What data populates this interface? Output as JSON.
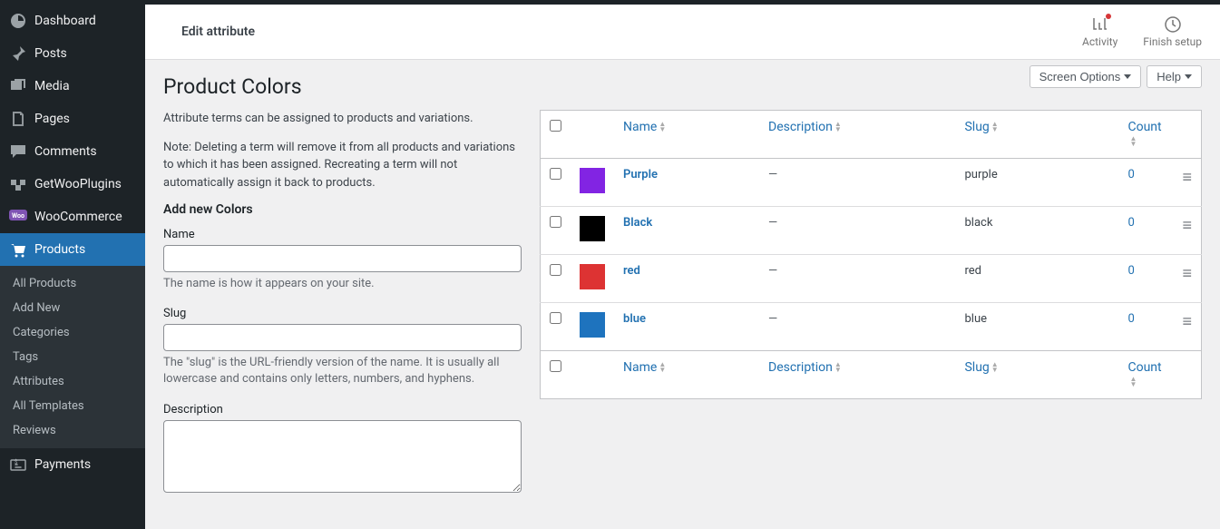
{
  "sidebar": {
    "items": [
      {
        "label": "Dashboard",
        "icon": "dashboard-icon"
      },
      {
        "label": "Posts",
        "icon": "pin-icon"
      },
      {
        "label": "Media",
        "icon": "media-icon"
      },
      {
        "label": "Pages",
        "icon": "pages-icon"
      },
      {
        "label": "Comments",
        "icon": "comments-icon"
      },
      {
        "label": "GetWooPlugins",
        "icon": "plugins-icon"
      },
      {
        "label": "WooCommerce",
        "icon": "woo-icon"
      },
      {
        "label": "Products",
        "icon": "products-icon"
      },
      {
        "label": "Payments",
        "icon": "payments-icon"
      }
    ],
    "sub": [
      {
        "label": "All Products"
      },
      {
        "label": "Add New"
      },
      {
        "label": "Categories"
      },
      {
        "label": "Tags"
      },
      {
        "label": "Attributes"
      },
      {
        "label": "All Templates"
      },
      {
        "label": "Reviews"
      }
    ]
  },
  "header": {
    "title": "Edit attribute",
    "activity": "Activity",
    "finish": "Finish setup"
  },
  "controls": {
    "screen_options": "Screen Options",
    "help": "Help"
  },
  "page": {
    "heading": "Product Colors",
    "intro": "Attribute terms can be assigned to products and variations.",
    "note": "Note: Deleting a term will remove it from all products and variations to which it has been assigned. Recreating a term will not automatically assign it back to products.",
    "form_heading": "Add new Colors",
    "name_label": "Name",
    "name_help": "The name is how it appears on your site.",
    "slug_label": "Slug",
    "slug_help": "The \"slug\" is the URL-friendly version of the name. It is usually all lowercase and contains only letters, numbers, and hyphens.",
    "desc_label": "Description"
  },
  "table": {
    "cols": {
      "name": "Name",
      "desc": "Description",
      "slug": "Slug",
      "count": "Count"
    },
    "rows": [
      {
        "name": "Purple",
        "desc": "—",
        "slug": "purple",
        "count": "0",
        "color": "#8224e3"
      },
      {
        "name": "Black",
        "desc": "—",
        "slug": "black",
        "count": "0",
        "color": "#000000"
      },
      {
        "name": "red",
        "desc": "—",
        "slug": "red",
        "count": "0",
        "color": "#dd3333"
      },
      {
        "name": "blue",
        "desc": "—",
        "slug": "blue",
        "count": "0",
        "color": "#1e73be"
      }
    ]
  }
}
